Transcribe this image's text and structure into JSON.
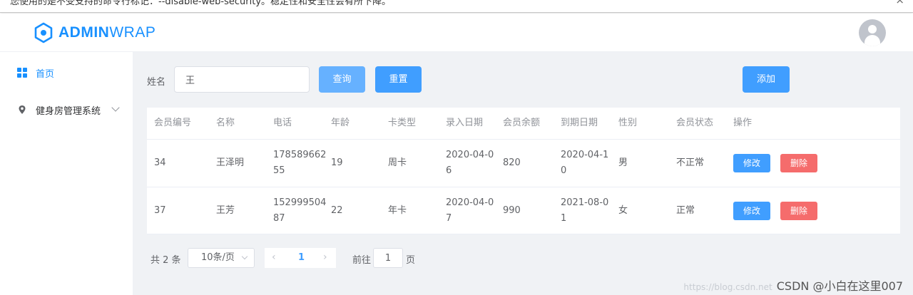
{
  "warning": {
    "text": "您使用的是不受支持的命令行标记：--disable-web-security。稳定性和安全性会有所下降。",
    "close": "×"
  },
  "header": {
    "logo_bold": "ADMIN",
    "logo_light": "WRAP"
  },
  "sidebar": {
    "items": [
      {
        "label": "首页"
      },
      {
        "label": "健身房管理系统"
      }
    ]
  },
  "toolbar": {
    "name_label": "姓名",
    "search_value": "王",
    "query_label": "查询",
    "reset_label": "重置",
    "add_label": "添加"
  },
  "table": {
    "columns": [
      "会员编号",
      "名称",
      "电话",
      "年龄",
      "卡类型",
      "录入日期",
      "会员余额",
      "到期日期",
      "性别",
      "会员状态",
      "操作"
    ],
    "rows": [
      {
        "id": "34",
        "name": "王泽明",
        "phone": "17858966255",
        "age": "19",
        "card": "周卡",
        "entry": "2020-04-06",
        "balance": "820",
        "expire": "2020-04-10",
        "gender": "男",
        "status": "不正常"
      },
      {
        "id": "37",
        "name": "王芳",
        "phone": "15299950487",
        "age": "22",
        "card": "年卡",
        "entry": "2020-04-07",
        "balance": "990",
        "expire": "2021-08-01",
        "gender": "女",
        "status": "正常"
      }
    ],
    "edit_label": "修改",
    "delete_label": "删除"
  },
  "pagination": {
    "total": "共 2 条",
    "page_size": "10条/页",
    "prev": "‹",
    "current": "1",
    "next": "›",
    "goto_label": "前往",
    "goto_value": "1",
    "page_suffix": "页"
  },
  "watermark": {
    "url": "https://blog.csdn.net",
    "text": "CSDN @小白在这里007"
  },
  "colors": {
    "primary": "#409eff",
    "primary_light": "#66b1ff",
    "danger": "#f56c6c",
    "brand": "#1890ff"
  }
}
